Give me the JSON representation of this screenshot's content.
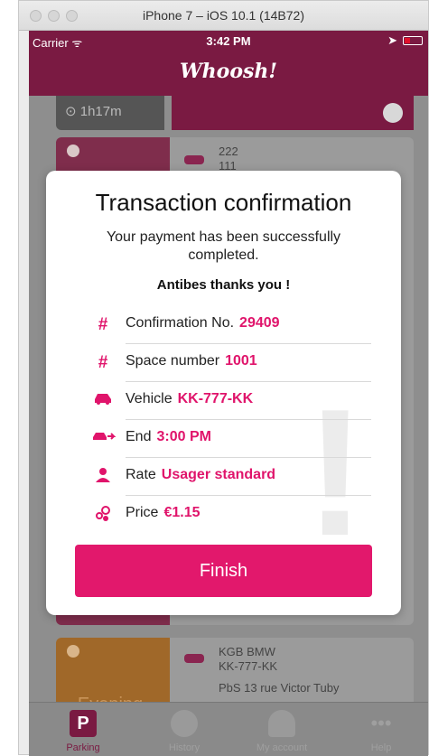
{
  "window": {
    "title": "iPhone 7 – iOS 10.1 (14B72)"
  },
  "status_bar": {
    "carrier": "Carrier ᯤ",
    "time": "3:42 PM"
  },
  "app": {
    "logo": "Whoosh!"
  },
  "background": {
    "top_timer": "1h17m",
    "card1_lines": [
      "222",
      "111"
    ],
    "card2_plate_name": "KGB BMW",
    "card2_plate": "KK-777-KK",
    "card2_address": "PbS 13 rue Victor Tuby",
    "card2_ticket": "Evening ticket"
  },
  "modal": {
    "title": "Transaction confirmation",
    "message": "Your payment has been successfully completed.",
    "thanks": "Antibes thanks you !",
    "rows": [
      {
        "icon": "hash-icon",
        "label": "Confirmation No.",
        "value": "29409"
      },
      {
        "icon": "hash-icon",
        "label": "Space number",
        "value": "1001"
      },
      {
        "icon": "car-icon",
        "label": "Vehicle",
        "value": "KK-777-KK"
      },
      {
        "icon": "car-arrow-icon",
        "label": "End",
        "value": "3:00 PM"
      },
      {
        "icon": "person-icon",
        "label": "Rate",
        "value": "Usager standard"
      },
      {
        "icon": "coins-icon",
        "label": "Price",
        "value": "€1.15"
      }
    ],
    "finish_label": "Finish"
  },
  "tabbar": {
    "tabs": [
      {
        "label": "Parking",
        "icon": "parking-icon",
        "active": true
      },
      {
        "label": "History",
        "icon": "clock-icon",
        "active": false
      },
      {
        "label": "My account",
        "icon": "person-icon",
        "active": false
      },
      {
        "label": "Help",
        "icon": "more-icon",
        "active": false
      }
    ]
  },
  "colors": {
    "accent": "#e2186c",
    "brand": "#7a1a42"
  }
}
